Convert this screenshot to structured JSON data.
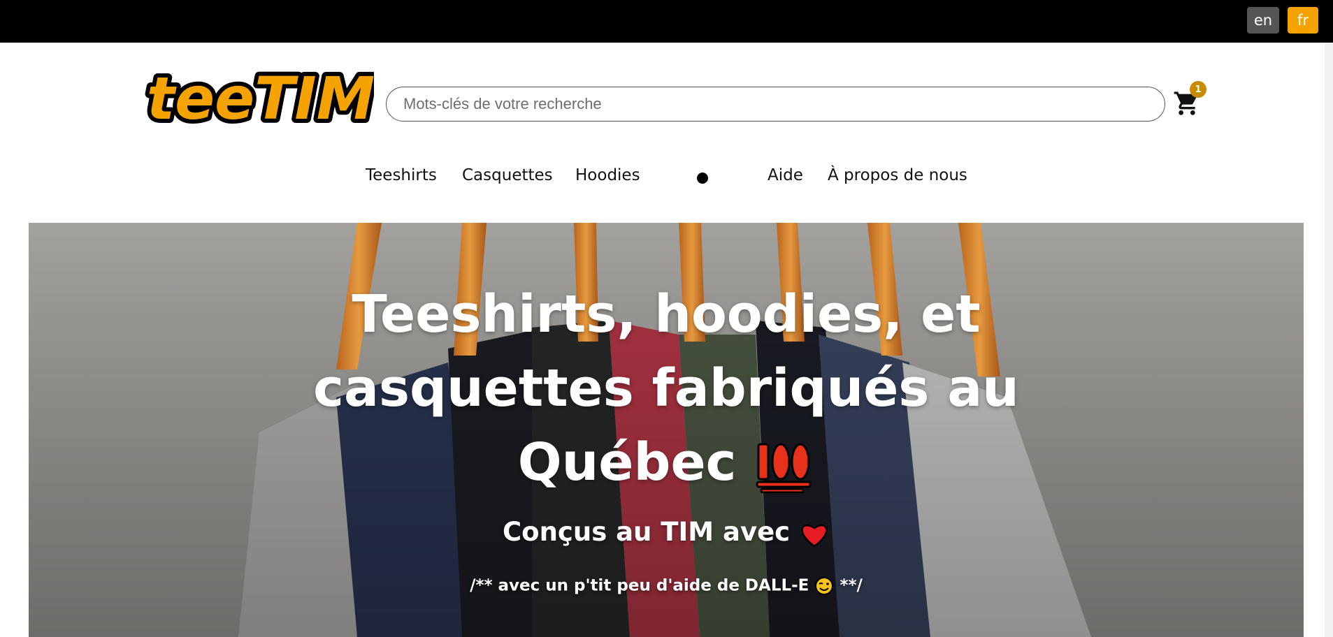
{
  "language_bar": {
    "en_label": "en",
    "fr_label": "fr",
    "active": "fr"
  },
  "header": {
    "logo_text": "teeTIM",
    "search_placeholder": "Mots-clés de votre recherche",
    "cart_count": "1",
    "cart_icon": "cart-icon"
  },
  "nav": {
    "items": [
      "Teeshirts",
      "Casquettes",
      "Hoodies",
      "Aide",
      "À propos de nous"
    ]
  },
  "hero": {
    "title_line1": "Teeshirts, hoodies, et",
    "title_line2": "casquettes fabriqués au",
    "title_line3": "Québec",
    "title_emoji": "hundred-points-icon",
    "subtitle": "Conçus au TIM avec",
    "subtitle_emoji": "heart-icon",
    "note_prefix": "/** avec un p'tit peu d'aide de DALL-E",
    "note_suffix": "**/",
    "note_emoji": "wink-face-icon"
  },
  "colors": {
    "accent": "#f5a300",
    "badge": "#c78b00",
    "topbar": "#000000"
  }
}
